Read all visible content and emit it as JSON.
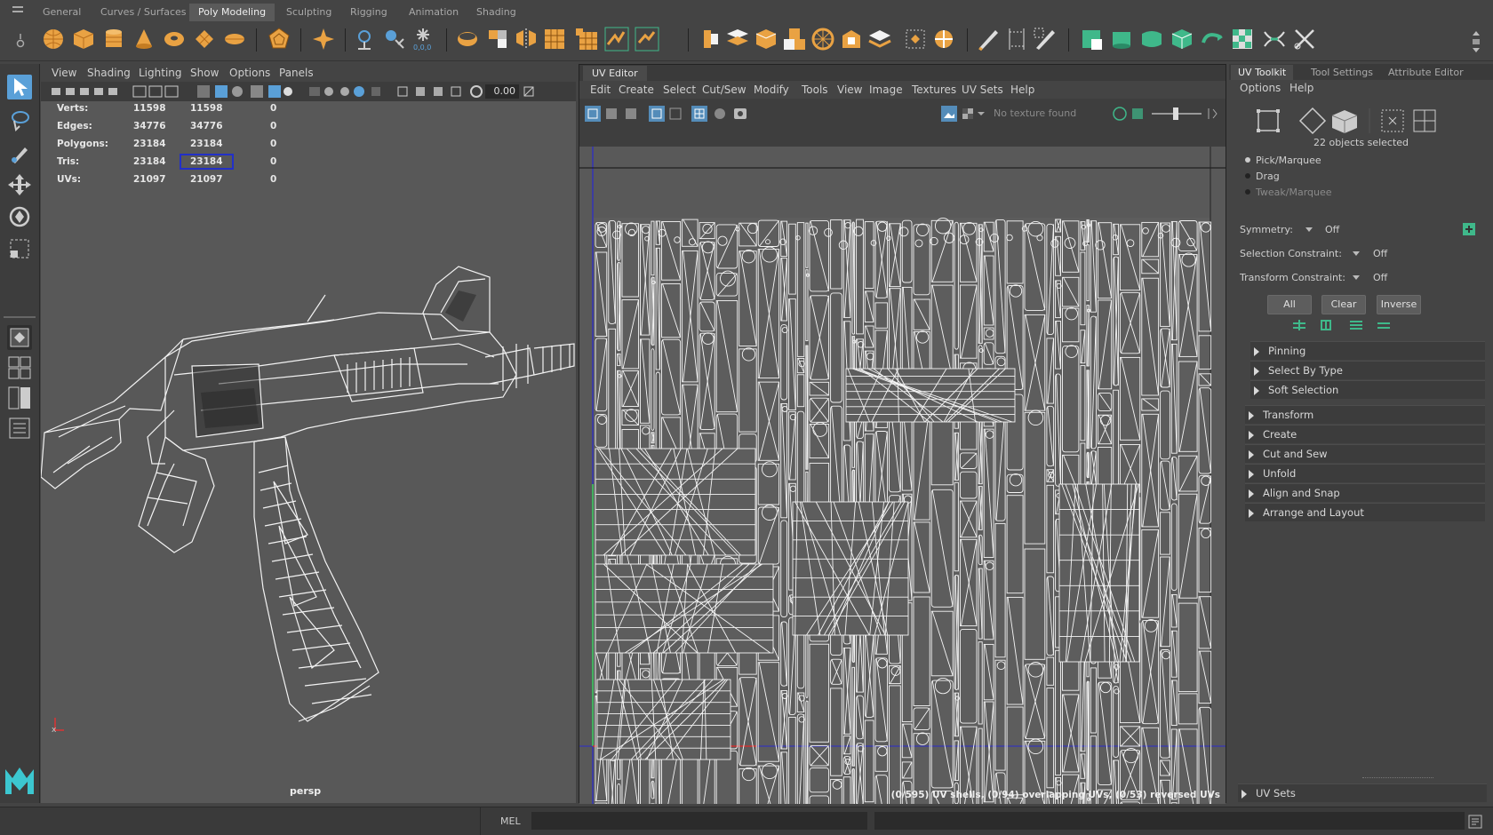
{
  "shelf": {
    "tabs": [
      "General",
      "Curves / Surfaces",
      "Poly Modeling",
      "Sculpting",
      "Rigging",
      "Animation",
      "Shading"
    ],
    "active_tab": "Poly Modeling"
  },
  "viewport": {
    "menu": [
      "View",
      "Shading",
      "Lighting",
      "Show",
      "Options",
      "Panels"
    ],
    "field_value": "0.00",
    "camera_label": "persp",
    "stats": [
      {
        "label": "Verts:",
        "a": "11598",
        "b": "11598",
        "c": "0"
      },
      {
        "label": "Edges:",
        "a": "34776",
        "b": "34776",
        "c": "0"
      },
      {
        "label": "Polygons:",
        "a": "23184",
        "b": "23184",
        "c": "0"
      },
      {
        "label": "Tris:",
        "a": "23184",
        "b": "23184",
        "c": "0"
      },
      {
        "label": "UVs:",
        "a": "21097",
        "b": "21097",
        "c": "0"
      }
    ]
  },
  "uv_editor": {
    "title": "UV Editor",
    "menu": [
      "Edit",
      "Create",
      "Select",
      "Cut/Sew",
      "Modify",
      "Tools",
      "View",
      "Image",
      "Textures",
      "UV Sets",
      "Help"
    ],
    "texture_placeholder": "No texture found",
    "status": "(0/595) UV shells, (0/94) overlapping UVs, (0/53) reversed UVs"
  },
  "toolkit": {
    "tabs": [
      "UV Toolkit",
      "Tool Settings",
      "Attribute Editor"
    ],
    "menu": [
      "Options",
      "Help"
    ],
    "selection_info": "22 objects selected",
    "modes": [
      "Pick/Marquee",
      "Drag",
      "Tweak/Marquee"
    ],
    "symmetry_label": "Symmetry:",
    "symmetry_value": "Off",
    "selection_constraint_label": "Selection Constraint:",
    "selection_constraint_value": "Off",
    "transform_constraint_label": "Transform Constraint:",
    "transform_constraint_value": "Off",
    "buttons": [
      "All",
      "Clear",
      "Inverse"
    ],
    "subsections": [
      "Pinning",
      "Select By Type",
      "Soft Selection"
    ],
    "sections": [
      "Transform",
      "Create",
      "Cut and Sew",
      "Unfold",
      "Align and Snap",
      "Arrange and Layout"
    ],
    "uv_sets_label": "UV Sets"
  },
  "cmdline": {
    "label": "MEL"
  },
  "colors": {
    "accent_blue": "#5aa0d8",
    "maya_logo": "#3cc7d0",
    "shelf_orange": "#e9a243",
    "shelf_green": "#3fb88a"
  }
}
